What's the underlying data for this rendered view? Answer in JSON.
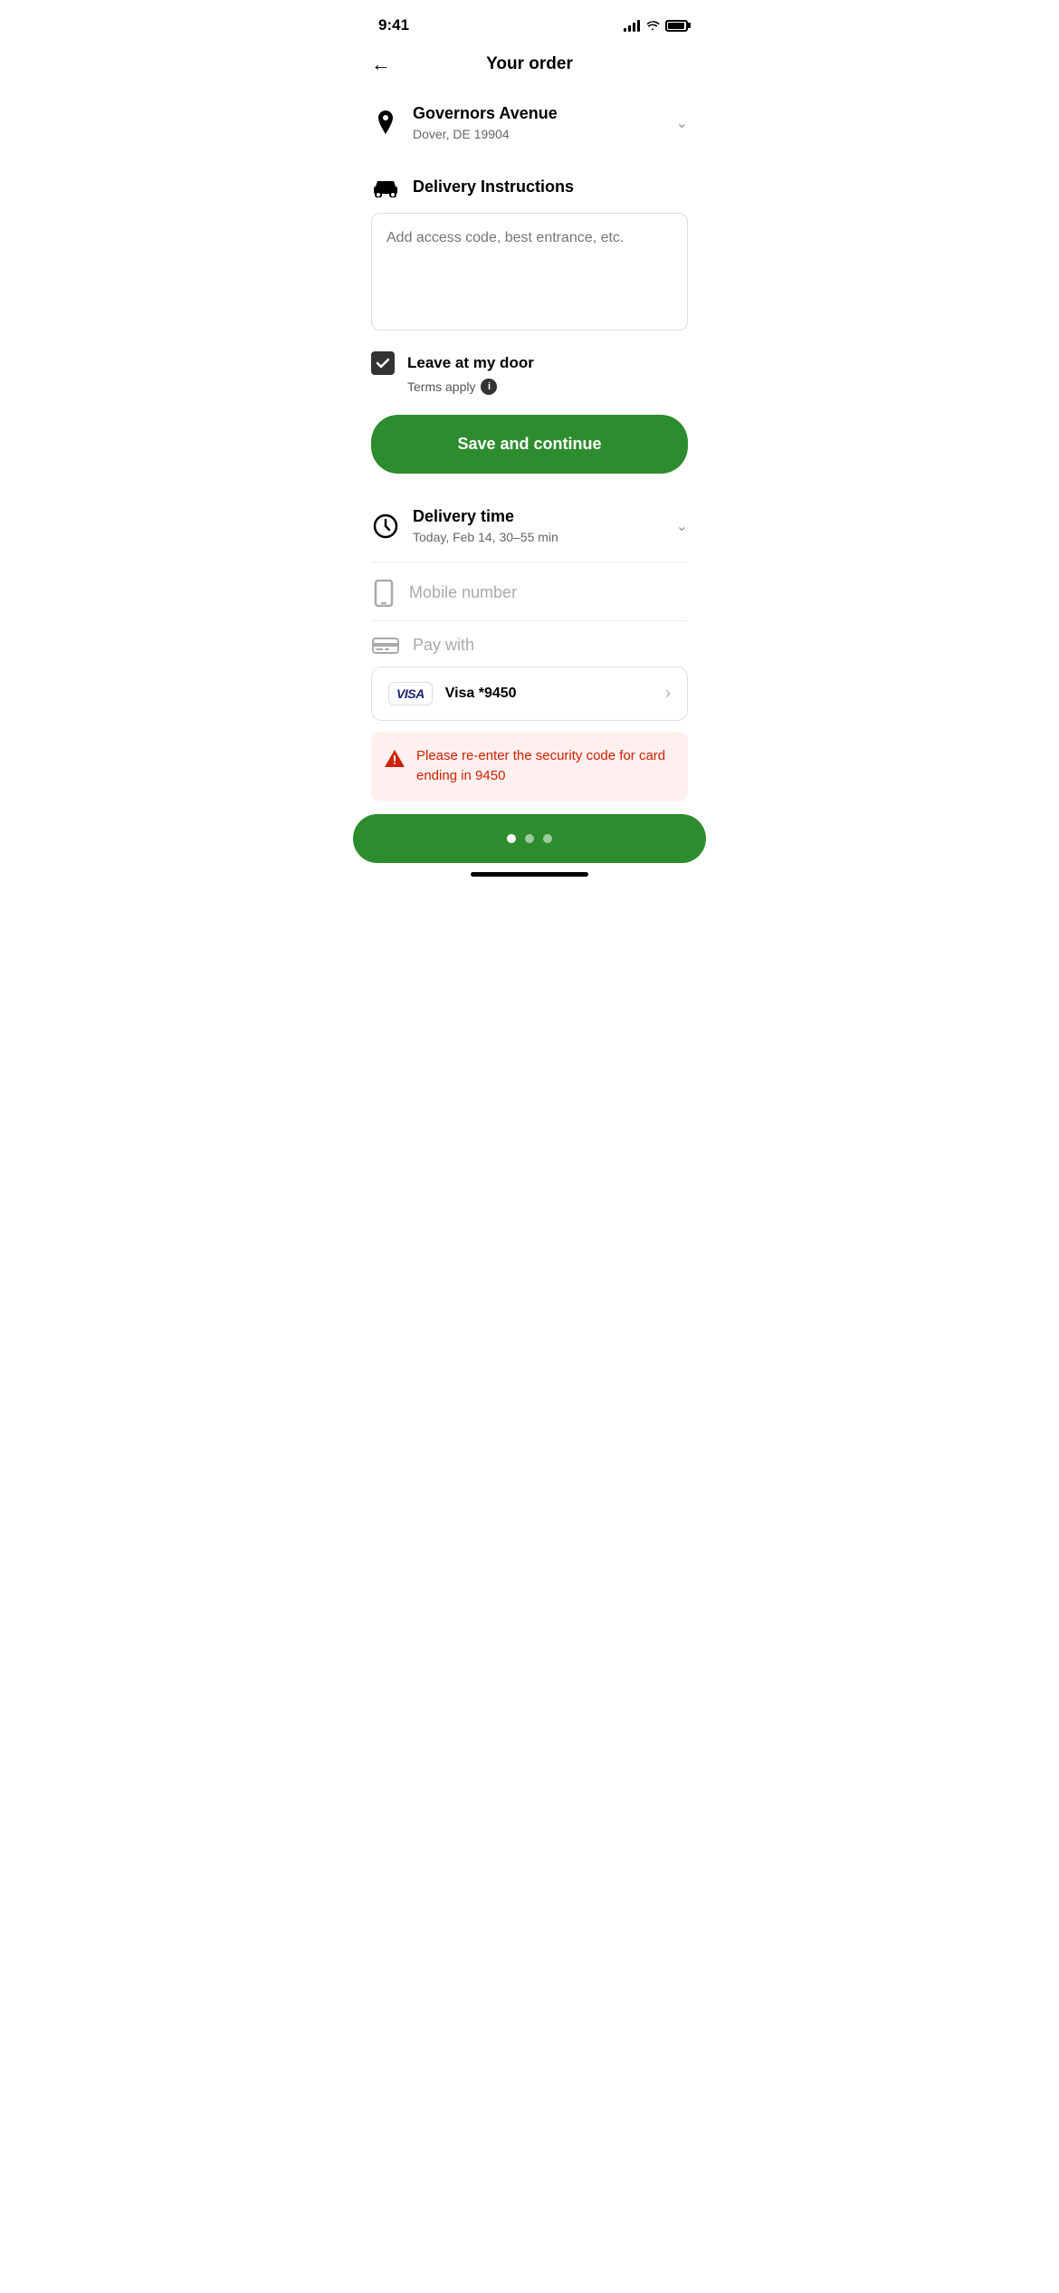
{
  "statusBar": {
    "time": "9:41"
  },
  "header": {
    "title": "Your order",
    "backLabel": "←"
  },
  "address": {
    "street": "Governors Avenue",
    "cityState": "Dover, DE 19904"
  },
  "deliveryInstructions": {
    "label": "Delivery Instructions",
    "placeholder": "Add access code, best entrance, etc."
  },
  "checkbox": {
    "label": "Leave at my door",
    "checked": true
  },
  "terms": {
    "label": "Terms apply"
  },
  "saveButton": {
    "label": "Save and continue"
  },
  "deliveryTime": {
    "label": "Delivery time",
    "subtext": "Today, Feb 14, 30–55 min"
  },
  "mobileNumber": {
    "label": "Mobile number"
  },
  "payWith": {
    "label": "Pay with"
  },
  "visa": {
    "logoText": "VISA",
    "cardLabel": "Visa *9450"
  },
  "errorBanner": {
    "text": "Please re-enter the security code for card ending in 9450"
  },
  "progressDots": {
    "dots": [
      "active",
      "inactive",
      "inactive"
    ]
  }
}
